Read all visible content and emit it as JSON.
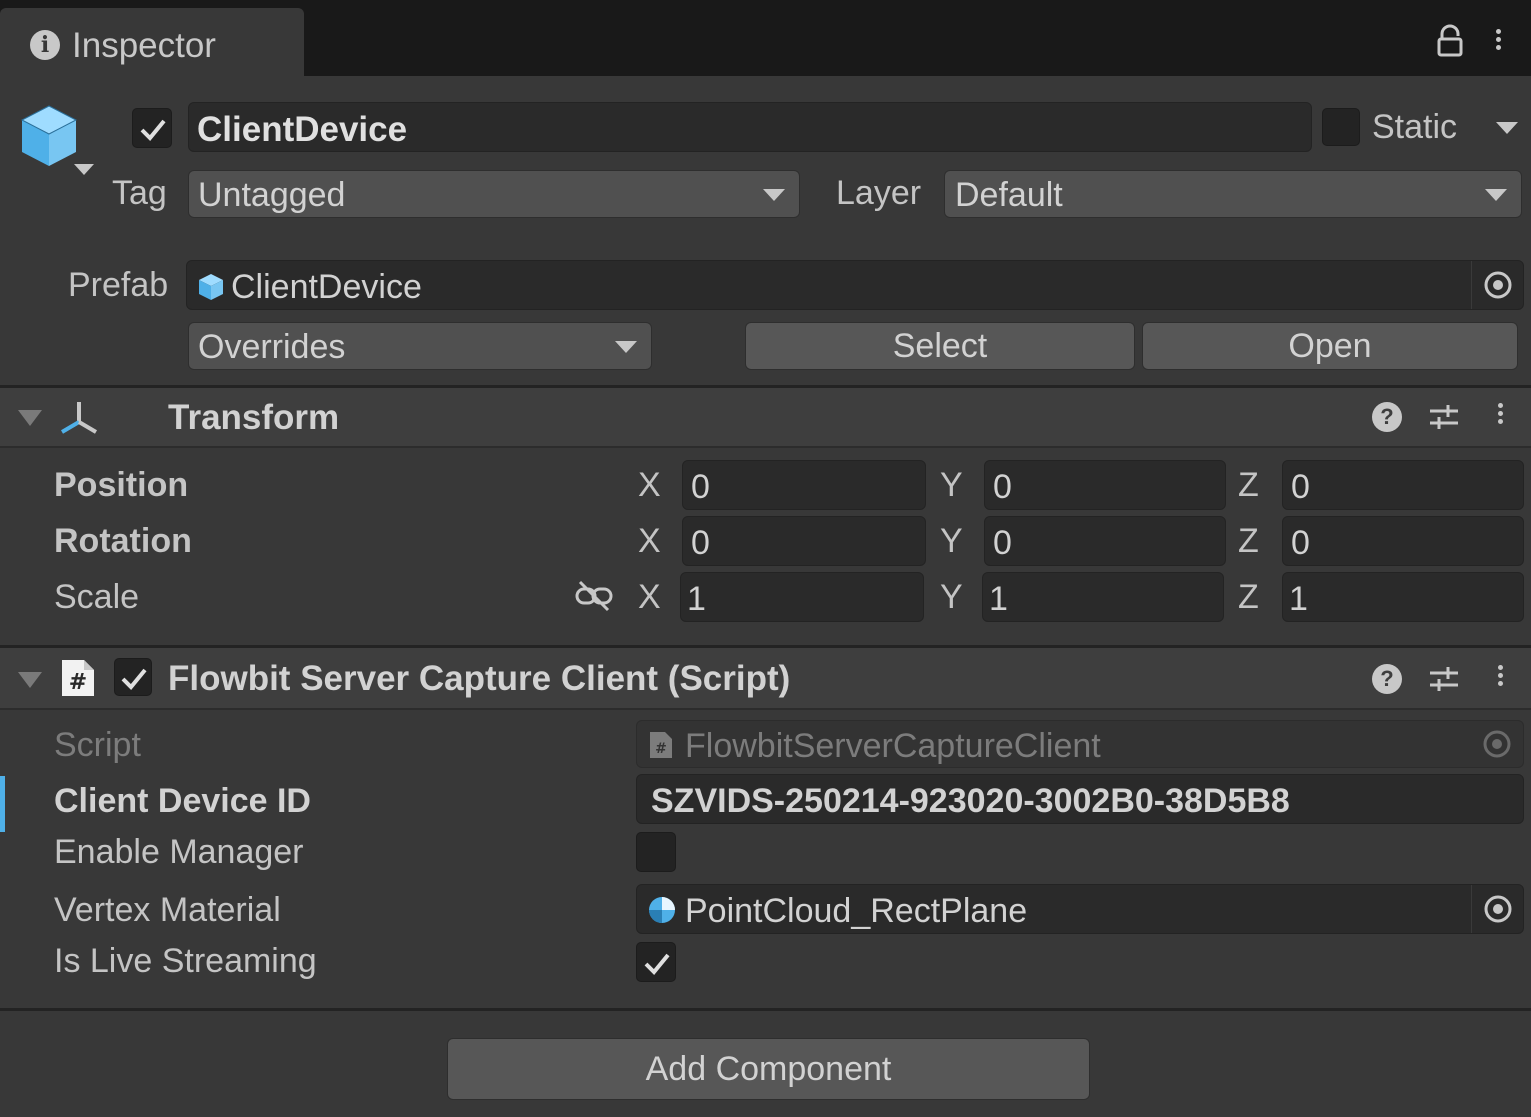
{
  "tab": {
    "title": "Inspector",
    "info_icon": "info-icon",
    "lock_icon": "lock-icon",
    "menu_icon": "kebab-menu-icon"
  },
  "gameobject": {
    "active": true,
    "name": "ClientDevice",
    "static_label": "Static",
    "static_checked": false,
    "tag_label": "Tag",
    "tag_value": "Untagged",
    "layer_label": "Layer",
    "layer_value": "Default",
    "icon": "cube-icon"
  },
  "prefab": {
    "label": "Prefab",
    "value": "ClientDevice",
    "overrides_label": "Overrides",
    "select_label": "Select",
    "open_label": "Open"
  },
  "transform": {
    "title": "Transform",
    "icon": "transform-axes-icon",
    "rows": [
      {
        "label": "Position",
        "x": "0",
        "y": "0",
        "z": "0"
      },
      {
        "label": "Rotation",
        "x": "0",
        "y": "0",
        "z": "0"
      },
      {
        "label": "Scale",
        "x": "1",
        "y": "1",
        "z": "1"
      }
    ],
    "axis_x": "X",
    "axis_y": "Y",
    "axis_z": "Z"
  },
  "script_component": {
    "title": "Flowbit Server Capture Client (Script)",
    "enabled": true,
    "icon": "csharp-script-icon",
    "script_label": "Script",
    "script_value": "FlowbitServerCaptureClient",
    "device_id_label": "Client Device ID",
    "device_id_value": "SZVIDS-250214-923020-3002B0-38D5B8",
    "enable_manager_label": "Enable Manager",
    "enable_manager_checked": false,
    "vertex_material_label": "Vertex Material",
    "vertex_material_value": "PointCloud_RectPlane",
    "live_streaming_label": "Is Live Streaming",
    "live_streaming_checked": true
  },
  "footer": {
    "add_component_label": "Add Component"
  },
  "colors": {
    "accent_blue": "#4fb0e8",
    "panel": "#383838",
    "field": "#2a2a2a",
    "titlebar": "#191919"
  }
}
